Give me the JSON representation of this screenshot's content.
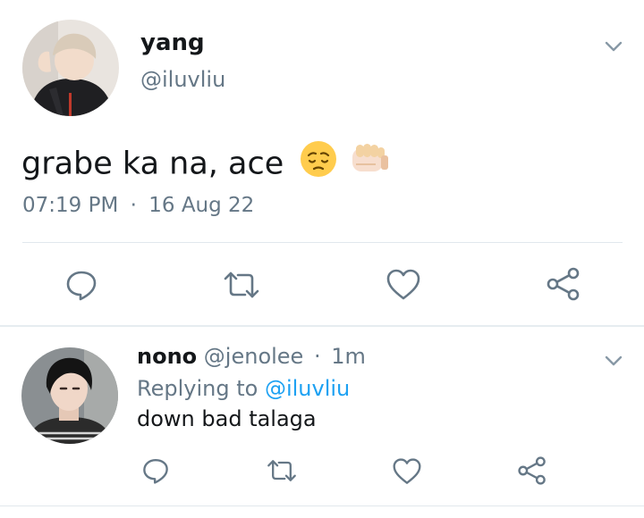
{
  "main_tweet": {
    "display_name": "yang",
    "handle": "@iluvliu",
    "text": "grabe ka na, ace",
    "emojis": [
      "pensive-face",
      "fist-bump-light-skin"
    ],
    "time": "07:19 PM",
    "separator": "·",
    "date": "16 Aug 22",
    "actions": [
      "reply-icon",
      "retweet-icon",
      "like-icon",
      "share-icon"
    ]
  },
  "reply": {
    "display_name": "nono",
    "handle": "@jenolee",
    "separator": "·",
    "age": "1m",
    "replying_prefix": "Replying to",
    "replying_to": "@iluvliu",
    "text": "down bad talaga",
    "actions": [
      "reply-icon",
      "retweet-icon",
      "like-icon",
      "share-icon"
    ]
  },
  "colors": {
    "text": "#14171a",
    "muted": "#657786",
    "link": "#1da1f2",
    "divider": "#e1e8ed"
  }
}
